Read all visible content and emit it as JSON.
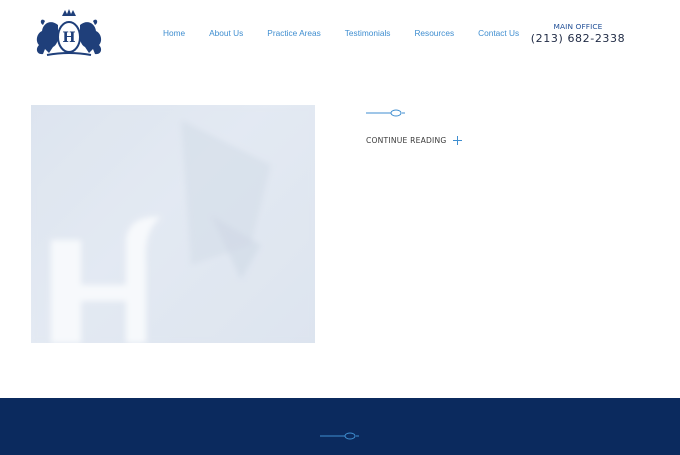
{
  "header": {
    "logo": {
      "icon": "lion-crest-logo-icon",
      "monogram": "H"
    },
    "nav": [
      {
        "label": "Home"
      },
      {
        "label": "About Us"
      },
      {
        "label": "Practice Areas"
      },
      {
        "label": "Testimonials"
      },
      {
        "label": "Resources"
      },
      {
        "label": "Contact Us"
      }
    ],
    "office": {
      "label": "MAIN OFFICE",
      "phone": "(213) 682-2338"
    }
  },
  "post": {
    "image": {
      "icon": "blurred-h-logo-image"
    },
    "continue_label": "CONTINUE READING",
    "continue_icon": "plus-icon"
  },
  "colors": {
    "accent": "#3f8ed0",
    "brand_navy": "#1f4e96",
    "footer_bg": "#0b2a5e"
  }
}
